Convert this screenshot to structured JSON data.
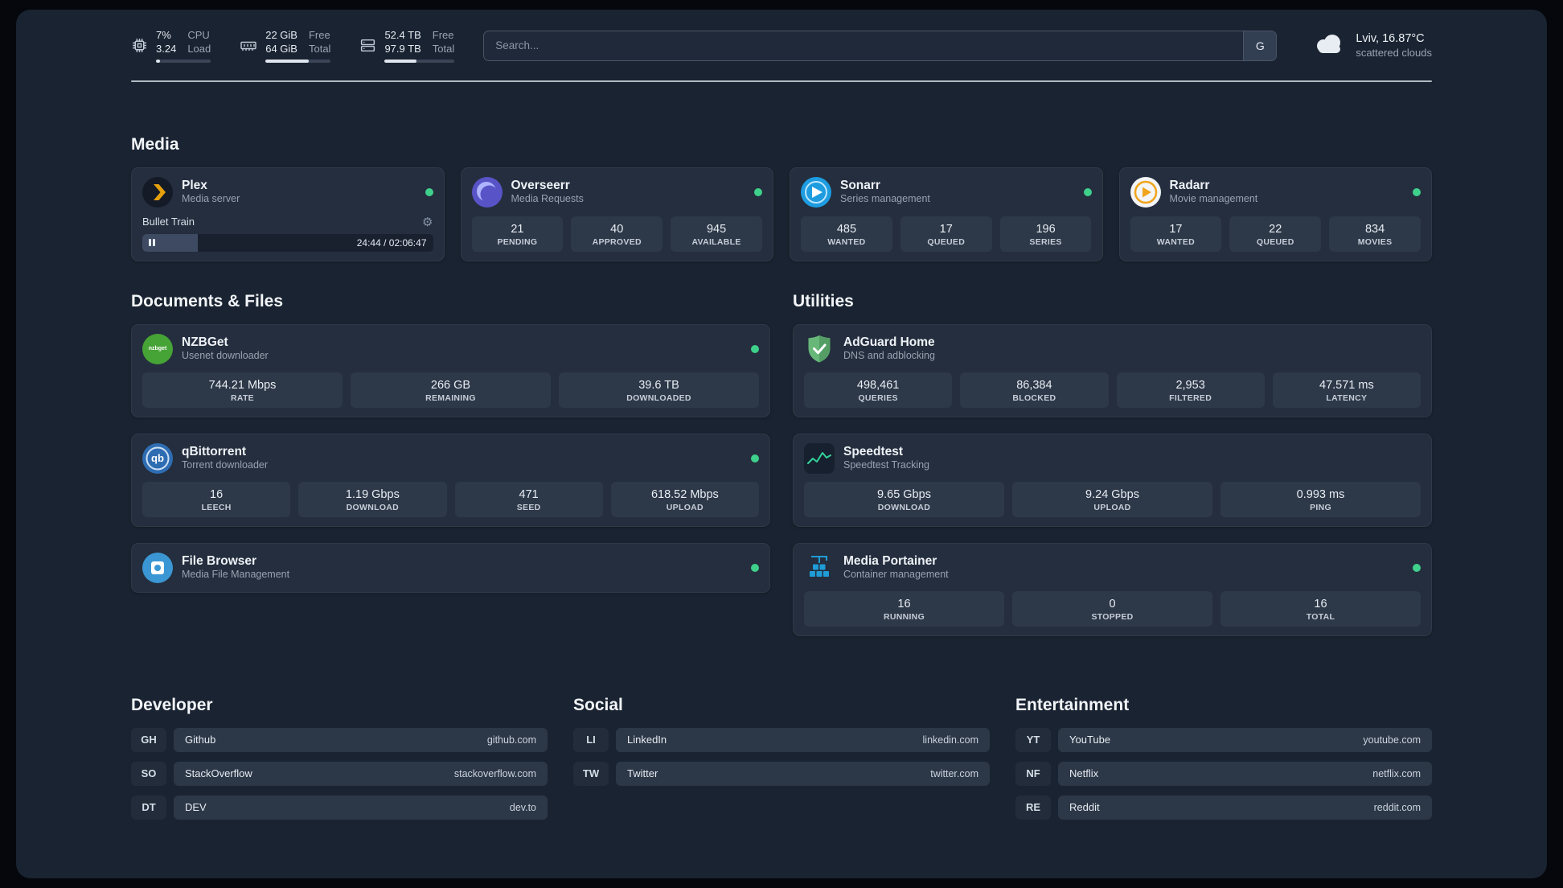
{
  "topbar": {
    "cpu": {
      "value_top": "7%",
      "value_bottom": "3.24",
      "label_top": "CPU",
      "label_bottom": "Load"
    },
    "memory": {
      "value_top": "22 GiB",
      "value_bottom": "64 GiB",
      "label_top": "Free",
      "label_bottom": "Total"
    },
    "disk": {
      "value_top": "52.4 TB",
      "value_bottom": "97.9 TB",
      "label_top": "Free",
      "label_bottom": "Total"
    },
    "search": {
      "placeholder": "Search...",
      "button": "G"
    },
    "weather": {
      "location": "Lviv, 16.87°C",
      "condition": "scattered clouds"
    }
  },
  "media": {
    "title": "Media",
    "cards": [
      {
        "name": "Plex",
        "subtitle": "Media server",
        "player": {
          "title": "Bullet Train",
          "time": "24:44 / 02:06:47",
          "progress_percent": 19
        }
      },
      {
        "name": "Overseerr",
        "subtitle": "Media Requests",
        "stats": [
          {
            "value": "21",
            "label": "PENDING"
          },
          {
            "value": "40",
            "label": "APPROVED"
          },
          {
            "value": "945",
            "label": "AVAILABLE"
          }
        ]
      },
      {
        "name": "Sonarr",
        "subtitle": "Series management",
        "stats": [
          {
            "value": "485",
            "label": "WANTED"
          },
          {
            "value": "17",
            "label": "QUEUED"
          },
          {
            "value": "196",
            "label": "SERIES"
          }
        ]
      },
      {
        "name": "Radarr",
        "subtitle": "Movie management",
        "stats": [
          {
            "value": "17",
            "label": "WANTED"
          },
          {
            "value": "22",
            "label": "QUEUED"
          },
          {
            "value": "834",
            "label": "MOVIES"
          }
        ]
      }
    ]
  },
  "documents": {
    "title": "Documents & Files",
    "cards": [
      {
        "name": "NZBGet",
        "subtitle": "Usenet downloader",
        "stats": [
          {
            "value": "744.21 Mbps",
            "label": "RATE"
          },
          {
            "value": "266 GB",
            "label": "REMAINING"
          },
          {
            "value": "39.6 TB",
            "label": "DOWNLOADED"
          }
        ]
      },
      {
        "name": "qBittorrent",
        "subtitle": "Torrent downloader",
        "stats": [
          {
            "value": "16",
            "label": "LEECH"
          },
          {
            "value": "1.19 Gbps",
            "label": "DOWNLOAD"
          },
          {
            "value": "471",
            "label": "SEED"
          },
          {
            "value": "618.52 Mbps",
            "label": "UPLOAD"
          }
        ]
      },
      {
        "name": "File Browser",
        "subtitle": "Media File Management"
      }
    ]
  },
  "utilities": {
    "title": "Utilities",
    "cards": [
      {
        "name": "AdGuard Home",
        "subtitle": "DNS and adblocking",
        "stats": [
          {
            "value": "498,461",
            "label": "QUERIES"
          },
          {
            "value": "86,384",
            "label": "BLOCKED"
          },
          {
            "value": "2,953",
            "label": "FILTERED"
          },
          {
            "value": "47.571 ms",
            "label": "LATENCY"
          }
        ]
      },
      {
        "name": "Speedtest",
        "subtitle": "Speedtest Tracking",
        "stats": [
          {
            "value": "9.65 Gbps",
            "label": "DOWNLOAD"
          },
          {
            "value": "9.24 Gbps",
            "label": "UPLOAD"
          },
          {
            "value": "0.993 ms",
            "label": "PING"
          }
        ]
      },
      {
        "name": "Media Portainer",
        "subtitle": "Container management",
        "stats": [
          {
            "value": "16",
            "label": "RUNNING"
          },
          {
            "value": "0",
            "label": "STOPPED"
          },
          {
            "value": "16",
            "label": "TOTAL"
          }
        ]
      }
    ]
  },
  "bookmarks": {
    "columns": [
      {
        "title": "Developer",
        "items": [
          {
            "abbr": "GH",
            "name": "Github",
            "url": "github.com"
          },
          {
            "abbr": "SO",
            "name": "StackOverflow",
            "url": "stackoverflow.com"
          },
          {
            "abbr": "DT",
            "name": "DEV",
            "url": "dev.to"
          }
        ]
      },
      {
        "title": "Social",
        "items": [
          {
            "abbr": "LI",
            "name": "LinkedIn",
            "url": "linkedin.com"
          },
          {
            "abbr": "TW",
            "name": "Twitter",
            "url": "twitter.com"
          }
        ]
      },
      {
        "title": "Entertainment",
        "items": [
          {
            "abbr": "YT",
            "name": "YouTube",
            "url": "youtube.com"
          },
          {
            "abbr": "NF",
            "name": "Netflix",
            "url": "netflix.com"
          },
          {
            "abbr": "RE",
            "name": "Reddit",
            "url": "reddit.com"
          }
        ]
      }
    ]
  },
  "colors": {
    "status_online": "#3fd08b",
    "background": "#1a2331",
    "card": "#242e3e"
  }
}
